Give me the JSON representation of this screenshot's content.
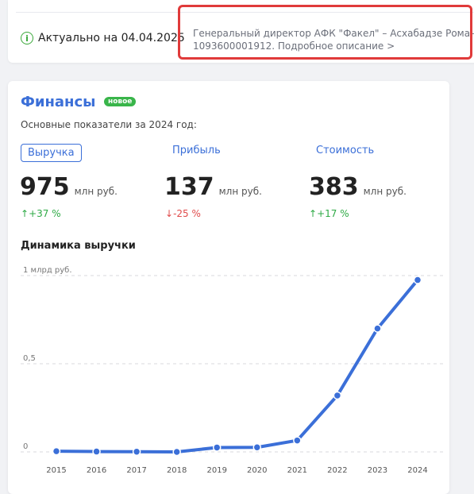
{
  "top": {
    "actual_label": "Актуально на 04.04.2025",
    "director_line1": "Генеральный директор АФК \"Факел\" – Асхабадзе Роман Г",
    "director_line2_prefix": "1093600001912. ",
    "director_link": "Подробное описание >"
  },
  "finance": {
    "title": "Финансы",
    "badge": "новое",
    "subtitle": "Основные показатели за 2024 год:",
    "tabs": [
      {
        "label": "Выручка",
        "active": true
      },
      {
        "label": "Прибыль",
        "active": false
      },
      {
        "label": "Стоимость",
        "active": false
      }
    ],
    "metrics": [
      {
        "value": "975",
        "unit": "млн руб.",
        "change": "+37 %",
        "direction": "up"
      },
      {
        "value": "137",
        "unit": "млн руб.",
        "change": "-25 %",
        "direction": "down"
      },
      {
        "value": "383",
        "unit": "млн руб.",
        "change": "+17 %",
        "direction": "up"
      }
    ],
    "dynamics_title": "Динамика выручки"
  },
  "arrows": {
    "up": "↑",
    "down": "↓"
  },
  "colors": {
    "accent": "#3b6fd8",
    "up": "#2eaa45",
    "down": "#e04b4b",
    "highlight": "#e03a3a"
  },
  "chart_data": {
    "type": "line",
    "x": [
      "2015",
      "2016",
      "2017",
      "2018",
      "2019",
      "2020",
      "2021",
      "2022",
      "2023",
      "2024"
    ],
    "series": [
      {
        "values": [
          0.004,
          0.002,
          0.001,
          0.0,
          0.025,
          0.026,
          0.065,
          0.32,
          0.7,
          0.975
        ]
      }
    ],
    "y_tick_labels": [
      "0",
      "0,5",
      "1 млрд руб."
    ],
    "y_ticks": [
      0,
      0.5,
      1.0
    ],
    "ylim": [
      0,
      1.0
    ],
    "grid": true,
    "line_color": "#3b6fd8"
  }
}
